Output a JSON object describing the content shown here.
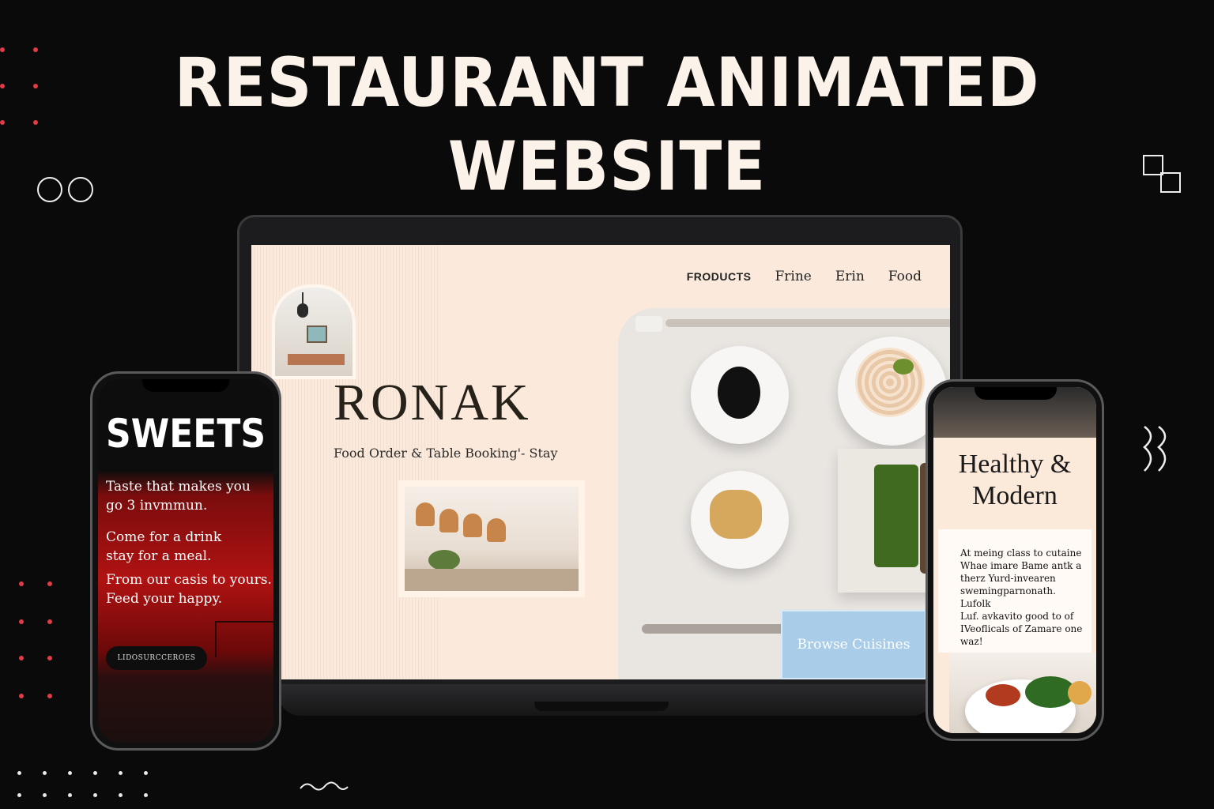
{
  "headline": {
    "line1": "RESTAURANT ANIMATED",
    "line2": "WEBSITE"
  },
  "laptop": {
    "nav": [
      "FRODUCTS",
      "Frine",
      "Erin",
      "Food"
    ],
    "brand": "RONAK",
    "tagline": "Food Order & Table Booking'- Stay",
    "browse_button": "Browse Cuisines"
  },
  "phone_left": {
    "title": "SWEETS",
    "line1": "Taste that makes you",
    "line2": "go 3 invmmun.",
    "line3": "Come for a drink",
    "line4": "stay for a meal.",
    "line5": "From our casis to yours.",
    "line6": "Feed your happy.",
    "button": "LIDOSURCCEROES"
  },
  "phone_right": {
    "title_line1": "Healthy &",
    "title_line2": "Modern",
    "body": [
      "At meing class to cutaine",
      "Whae imare Bame antk a",
      "therz Yurd-invearen",
      "swemingparnonath. Lufolk",
      "Luf. avkavito good to of",
      "IVeoflicals of Zamare one",
      "waz!"
    ]
  },
  "colors": {
    "background": "#0a0a0a",
    "accent_red": "#e23b45",
    "screen_cream": "#fbeadb",
    "browse_blue": "#a9cde8"
  }
}
